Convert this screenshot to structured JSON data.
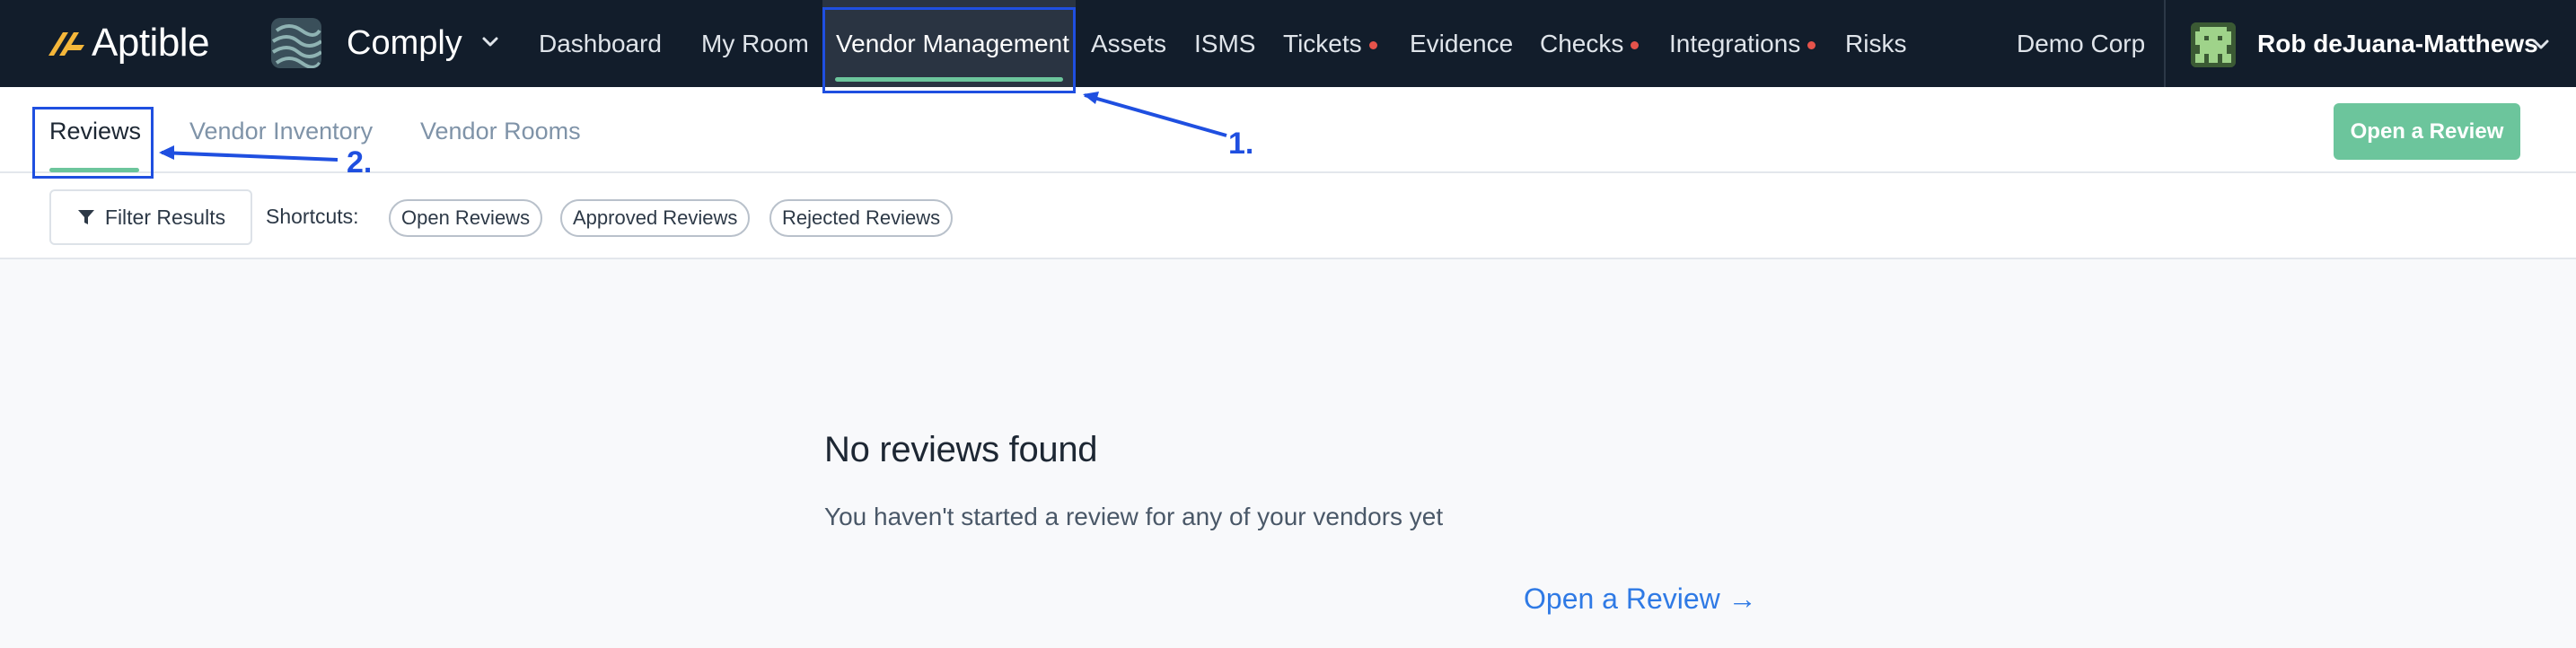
{
  "brand": {
    "name": "Aptible"
  },
  "product": {
    "name": "Comply"
  },
  "nav": [
    {
      "label": "Dashboard",
      "alert": false
    },
    {
      "label": "My Room",
      "alert": false
    },
    {
      "label": "Vendor Management",
      "alert": false,
      "active": true
    },
    {
      "label": "Assets",
      "alert": false
    },
    {
      "label": "ISMS",
      "alert": false
    },
    {
      "label": "Tickets",
      "alert": true
    },
    {
      "label": "Evidence",
      "alert": false
    },
    {
      "label": "Checks",
      "alert": true
    },
    {
      "label": "Integrations",
      "alert": true
    },
    {
      "label": "Risks",
      "alert": false
    }
  ],
  "org": {
    "name": "Demo Corp"
  },
  "user": {
    "name": "Rob deJuana-Matthews"
  },
  "tabs": [
    {
      "label": "Reviews",
      "active": true
    },
    {
      "label": "Vendor Inventory",
      "active": false
    },
    {
      "label": "Vendor Rooms",
      "active": false
    }
  ],
  "actions": {
    "open_review": "Open a Review"
  },
  "filter": {
    "button_label": "Filter Results",
    "shortcuts_label": "Shortcuts:",
    "shortcuts": [
      "Open Reviews",
      "Approved Reviews",
      "Rejected Reviews"
    ]
  },
  "empty_state": {
    "title": "No reviews found",
    "description": "You haven't started a review for any of your vendors yet",
    "link": "Open a Review →"
  },
  "annotations": [
    "1.",
    "2."
  ],
  "colors": {
    "navbar_bg": "#121d2b",
    "accent_green": "#6cc59c",
    "link_blue": "#2f7ae5",
    "alert_red": "#e5534b",
    "annotation_blue": "#1f4fe0"
  }
}
